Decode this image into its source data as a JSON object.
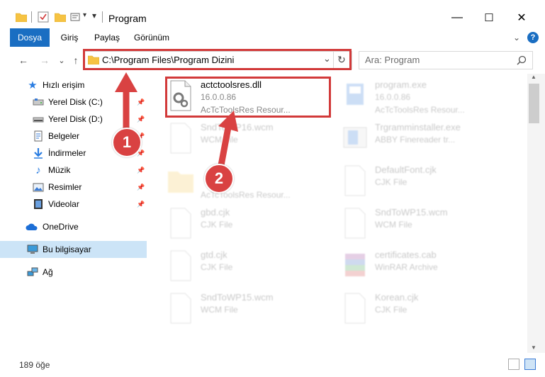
{
  "window": {
    "title": "Program",
    "minimize_glyph": "—",
    "maximize_glyph": "☐",
    "close_glyph": "✕"
  },
  "ribbon": {
    "tabs": [
      "Dosya",
      "Giriş",
      "Paylaş",
      "Görünüm"
    ],
    "active_tab": "Dosya",
    "active_color": "#1a6ec2",
    "help_glyph": "?",
    "collapse_glyph": "⌄"
  },
  "nav": {
    "back_glyph": "←",
    "forward_glyph": "→",
    "recent_glyph": "⌄",
    "up_glyph": "↑",
    "address": "C:\\Program Files\\Program Dizini",
    "address_dropdown_glyph": "⌄",
    "refresh_glyph": "↻",
    "search_placeholder": "Ara: Program",
    "search_icon": "search-icon"
  },
  "sidebar": {
    "items": [
      {
        "label": "Hızlı erişim",
        "icon": "star-icon",
        "pinned": false
      },
      {
        "label": "Yerel Disk (C:)",
        "icon": "drive-icon",
        "pinned": true
      },
      {
        "label": "Yerel Disk (D:)",
        "icon": "drive-icon",
        "pinned": true
      },
      {
        "label": "Belgeler",
        "icon": "documents-icon",
        "pinned": true
      },
      {
        "label": "İndirmeler",
        "icon": "downloads-icon",
        "pinned": true
      },
      {
        "label": "Müzik",
        "icon": "music-icon",
        "pinned": true
      },
      {
        "label": "Resimler",
        "icon": "pictures-icon",
        "pinned": true
      },
      {
        "label": "Videolar",
        "icon": "videos-icon",
        "pinned": true
      },
      {
        "label": "OneDrive",
        "icon": "cloud-icon",
        "pinned": false
      },
      {
        "label": "Bu bilgisayar",
        "icon": "computer-icon",
        "pinned": false
      },
      {
        "label": "Ağ",
        "icon": "network-icon",
        "pinned": false
      }
    ],
    "selected": "Bu bilgisayar",
    "pin_glyph": "📌"
  },
  "files": [
    {
      "name": "actctoolsres.dll",
      "line2": "16.0.0.86",
      "line3": "AcTcToolsRes Resour...",
      "icon": "dll-gear-icon",
      "highlighted": true
    },
    {
      "name": "program.exe",
      "line2": "16.0.0.86",
      "line3": "AcTcToolsRes Resour...",
      "icon": "exe-icon",
      "highlighted": false
    },
    {
      "name": "SndToWP16.wcm",
      "line2": "WCM File",
      "line3": "",
      "icon": "file-icon",
      "highlighted": false
    },
    {
      "name": "Trgramminstaller.exe",
      "line2": "ABBY Finereader tr...",
      "line3": "",
      "icon": "installer-icon",
      "highlighted": false
    },
    {
      "name": "",
      "line2": "",
      "line3": "AcTcToolsRes Resour...",
      "icon": "folder-icon",
      "highlighted": false
    },
    {
      "name": "DefaultFont.cjk",
      "line2": "CJK File",
      "line3": "",
      "icon": "file-icon",
      "highlighted": false
    },
    {
      "name": "gbd.cjk",
      "line2": "CJK File",
      "line3": "",
      "icon": "file-icon",
      "highlighted": false
    },
    {
      "name": "SndToWP15.wcm",
      "line2": "WCM File",
      "line3": "",
      "icon": "file-icon",
      "highlighted": false
    },
    {
      "name": "gtd.cjk",
      "line2": "CJK File",
      "line3": "",
      "icon": "file-icon",
      "highlighted": false
    },
    {
      "name": "certificates.cab",
      "line2": "WinRAR Archive",
      "line3": "",
      "icon": "archive-icon",
      "highlighted": false
    },
    {
      "name": "SndToWP15.wcm",
      "line2": "WCM File",
      "line3": "",
      "icon": "file-icon",
      "highlighted": false
    },
    {
      "name": "Korean.cjk",
      "line2": "CJK File",
      "line3": "",
      "icon": "file-icon",
      "highlighted": false
    }
  ],
  "annotations": {
    "step1": "1",
    "step2": "2",
    "color": "#d23a3a"
  },
  "status": {
    "item_count": "189 öğe"
  }
}
